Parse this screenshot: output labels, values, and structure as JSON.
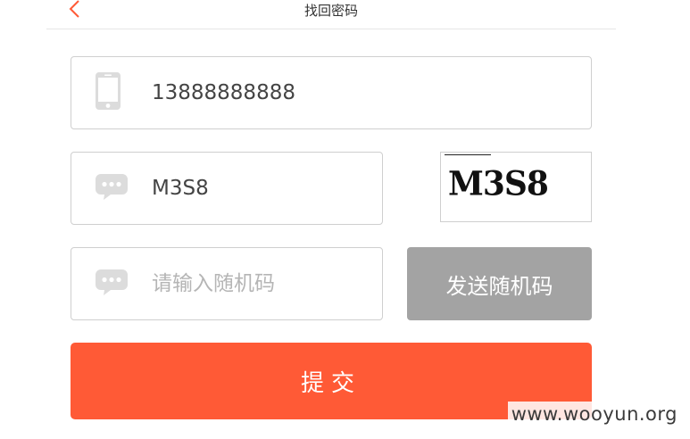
{
  "header": {
    "title": "找回密码"
  },
  "phone": {
    "value": "13888888888",
    "icon": "phone-icon"
  },
  "captcha": {
    "value": "M3S8",
    "image_text": "M3S8",
    "icon": "chat-bubble-icon"
  },
  "sms_code": {
    "value": "",
    "placeholder": "请输入随机码",
    "icon": "chat-bubble-icon"
  },
  "send_button": {
    "label": "发送随机码",
    "color": "#a3a3a3"
  },
  "submit_button": {
    "label": "提交",
    "color": "#ff5a36"
  },
  "accent_color": "#ff5a36",
  "watermark": "www.wooyun.org"
}
